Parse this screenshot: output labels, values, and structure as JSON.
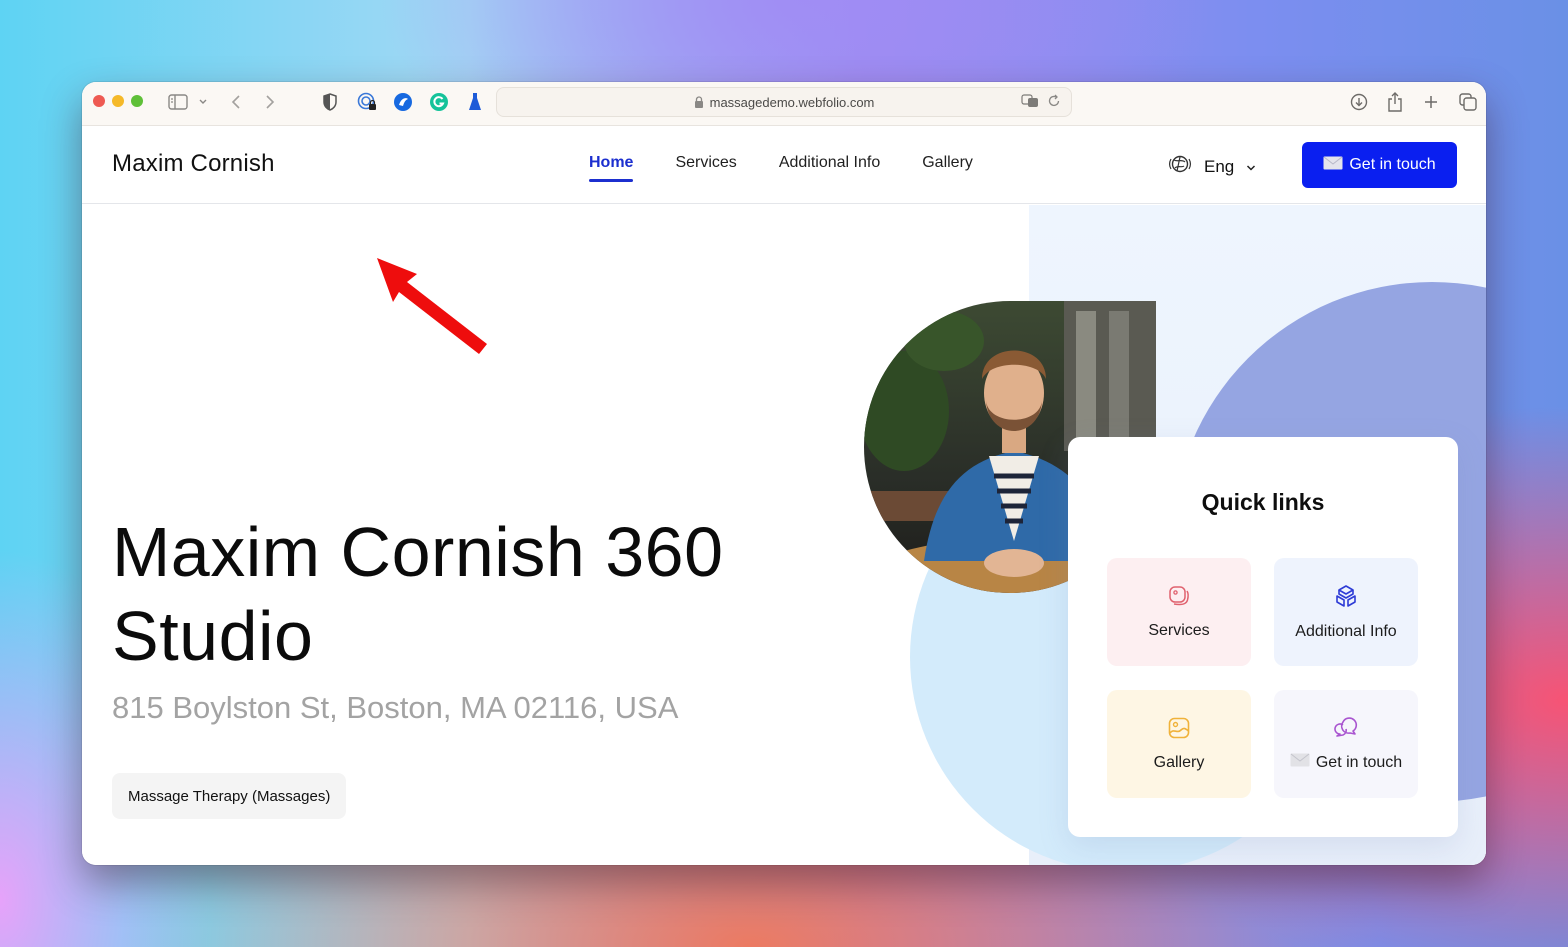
{
  "browser": {
    "url": "massagedemo.webfolio.com",
    "toolbar_icons": [
      "sidebar-icon",
      "chevron-down-icon",
      "back-icon",
      "forward-icon",
      "shield-icon",
      "password-extension-icon",
      "browser-extension-icon",
      "grammarly-icon",
      "flask-extension-icon"
    ],
    "right_icons": [
      "download-icon",
      "share-icon",
      "new-tab-icon",
      "tabs-overview-icon"
    ]
  },
  "site": {
    "brand": "Maxim Cornish",
    "nav": [
      {
        "label": "Home",
        "active": true
      },
      {
        "label": "Services",
        "active": false
      },
      {
        "label": "Additional Info",
        "active": false
      },
      {
        "label": "Gallery",
        "active": false
      }
    ],
    "language": "Eng",
    "cta_label": "Get in touch",
    "accent_color": "#0a1ff0",
    "nav_active_color": "#1c2fcf"
  },
  "hero": {
    "title": "Maxim Cornish 360 Studio",
    "address": "815 Boylston St, Boston, MA 02116, USA",
    "tag": "Massage Therapy (Massages)"
  },
  "quick_links": {
    "title": "Quick links",
    "items": [
      {
        "label": "Services",
        "icon": "stack-icon",
        "color": "#e0626f",
        "bg": "#fdeff1"
      },
      {
        "label": "Additional Info",
        "icon": "cube-icon",
        "color": "#2d3bd6",
        "bg": "#eef3fd"
      },
      {
        "label": "Gallery",
        "icon": "image-icon",
        "color": "#f0b23a",
        "bg": "#fef6e4"
      },
      {
        "label": "Get in touch",
        "icon": "chat-bubbles-icon",
        "color": "#a955d0",
        "bg": "#f6f6fc"
      }
    ]
  },
  "annotation": {
    "type": "red-arrow",
    "points_to": "brand"
  }
}
